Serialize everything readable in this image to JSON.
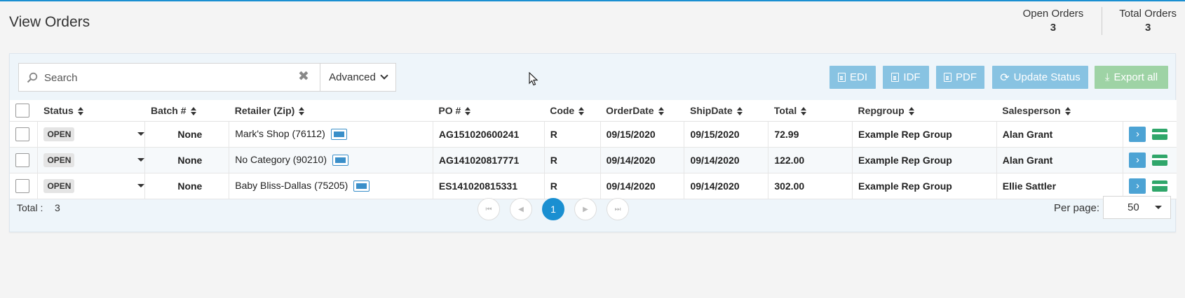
{
  "page": {
    "title": "View Orders",
    "open_orders_label": "Open Orders",
    "open_orders_count": "3",
    "total_orders_label": "Total Orders",
    "total_orders_count": "3"
  },
  "toolbar": {
    "search_placeholder": "Search",
    "search_value": "",
    "advanced_label": "Advanced",
    "edi_label": "EDI",
    "idf_label": "IDF",
    "pdf_label": "PDF",
    "update_status_label": "Update Status",
    "export_all_label": "Export all"
  },
  "table": {
    "columns": [
      "Status",
      "Batch #",
      "Retailer (Zip)",
      "PO #",
      "Code",
      "OrderDate",
      "ShipDate",
      "Total",
      "Repgroup",
      "Salesperson"
    ],
    "rows": [
      {
        "status": "OPEN",
        "batch": "None",
        "retailer": "Mark's Shop (76112)",
        "po": "AG151020600241",
        "code": "R",
        "order_date": "09/15/2020",
        "ship_date": "09/15/2020",
        "total": "72.99",
        "repgroup": "Example Rep Group",
        "salesperson": "Alan Grant"
      },
      {
        "status": "OPEN",
        "batch": "None",
        "retailer": "No Category (90210)",
        "po": "AG141020817771",
        "code": "R",
        "order_date": "09/14/2020",
        "ship_date": "09/14/2020",
        "total": "122.00",
        "repgroup": "Example Rep Group",
        "salesperson": "Alan Grant"
      },
      {
        "status": "OPEN",
        "batch": "None",
        "retailer": "Baby Bliss-Dallas (75205)",
        "po": "ES141020815331",
        "code": "R",
        "order_date": "09/14/2020",
        "ship_date": "09/14/2020",
        "total": "302.00",
        "repgroup": "Example Rep Group",
        "salesperson": "Ellie Sattler"
      }
    ]
  },
  "footer": {
    "total_label": "Total :",
    "total_value": "3",
    "current_page": "1",
    "per_page_label": "Per page:",
    "per_page_value": "50"
  },
  "colors": {
    "accent": "#1a8fd1",
    "light_blue_button": "#88c3e2",
    "light_green_button": "#9ed3a5",
    "card_green": "#2fa66a"
  }
}
